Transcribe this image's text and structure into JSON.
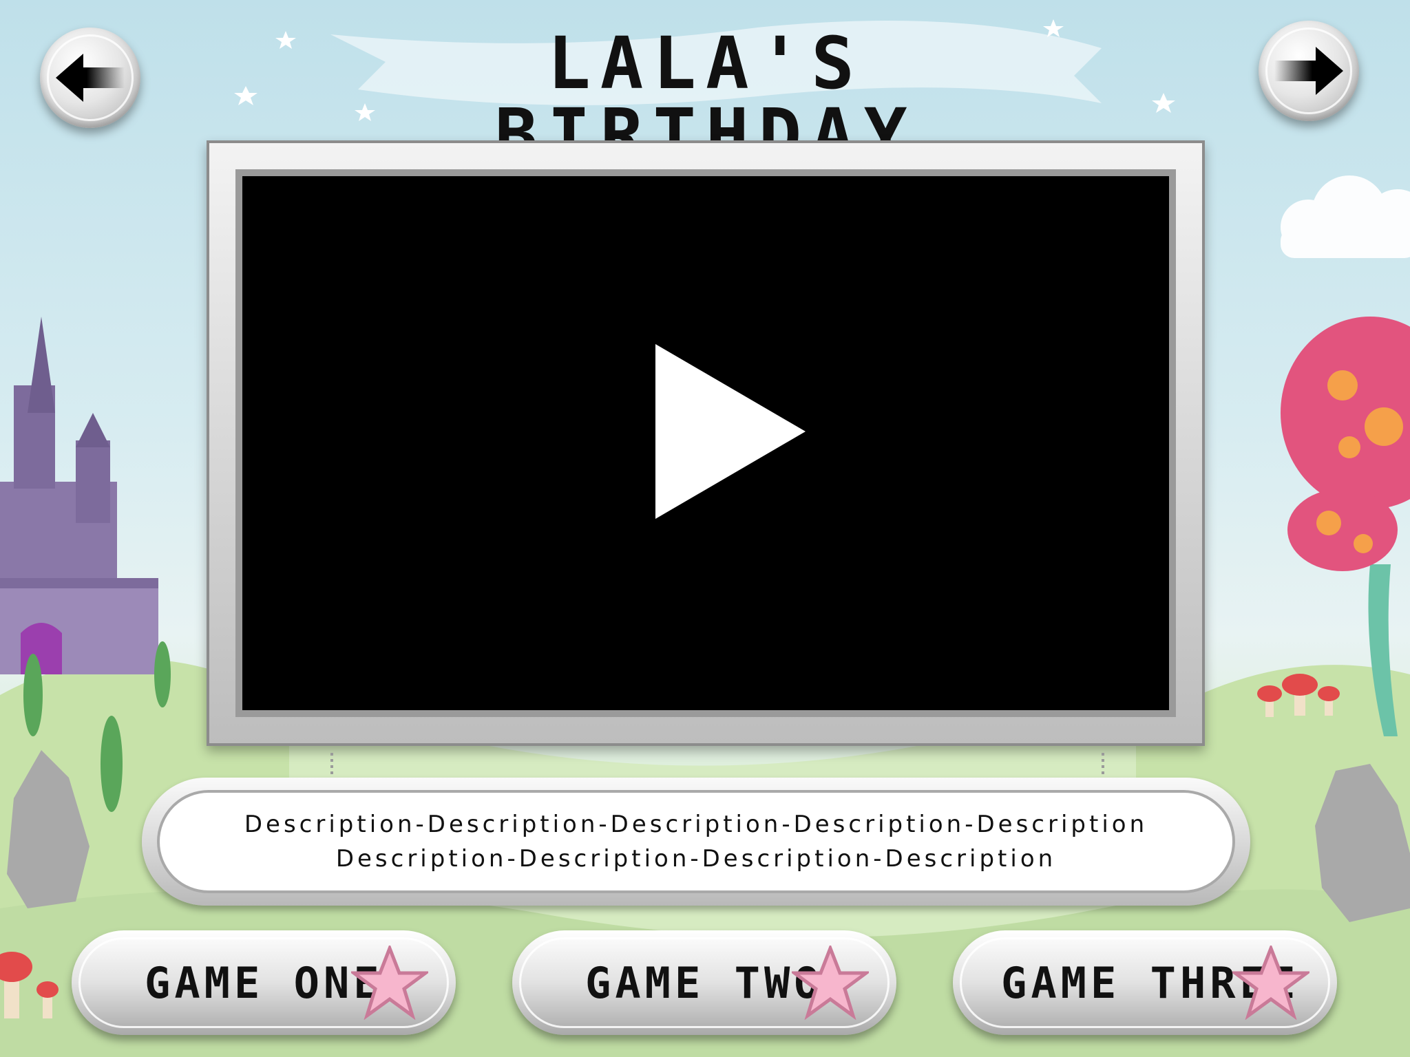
{
  "header": {
    "title": "LALA'S BIRTHDAY",
    "back_icon": "arrow-left-icon",
    "next_icon": "arrow-right-icon"
  },
  "video": {
    "play_icon": "play-icon"
  },
  "description": {
    "line1": "Description-Description-Description-Description-Description",
    "line2": "Description-Description-Description-Description"
  },
  "games": [
    {
      "label": "GAME ONE",
      "icon": "star-icon"
    },
    {
      "label": "GAME TWO",
      "icon": "star-icon"
    },
    {
      "label": "GAME THREE",
      "icon": "star-icon"
    }
  ],
  "colors": {
    "sky": "#bfe0ea",
    "grass": "#c6e2b0",
    "star_pink": "#f7b6cd",
    "castle": "#8a78a8",
    "tree": "#e2547e"
  }
}
